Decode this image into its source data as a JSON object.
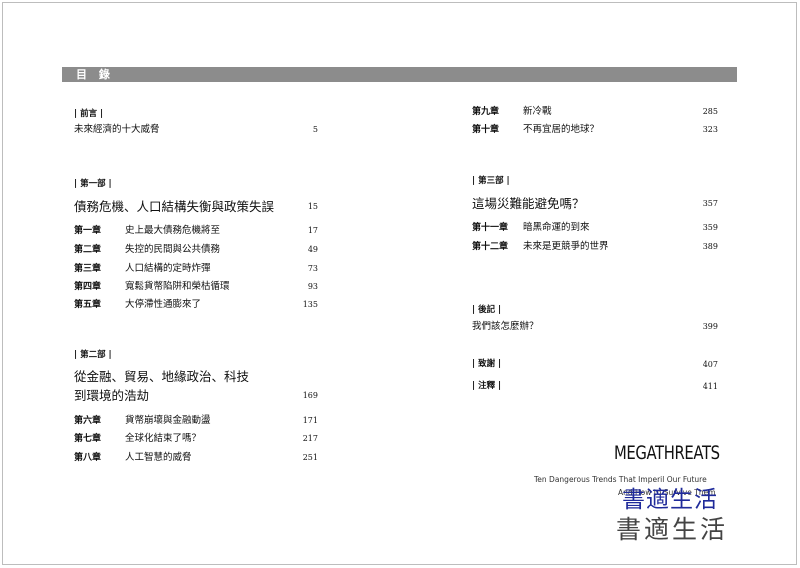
{
  "header": {
    "title": "目 錄"
  },
  "left": {
    "preface_tag": "| 前言 |",
    "preface": {
      "title": "未來經濟的十大威脅",
      "page": "5"
    },
    "part1": {
      "tag": "| 第一部 |",
      "title": "債務危機、人口結構失衡與政策失誤",
      "page": "15",
      "chapters": [
        {
          "num": "第一章",
          "title": "史上最大債務危機將至",
          "page": "17"
        },
        {
          "num": "第二章",
          "title": "失控的民間與公共債務",
          "page": "49"
        },
        {
          "num": "第三章",
          "title": "人口結構的定時炸彈",
          "page": "73"
        },
        {
          "num": "第四章",
          "title": "寬鬆貨幣陷阱和榮枯循環",
          "page": "93"
        },
        {
          "num": "第五章",
          "title": "大停滯性通膨來了",
          "page": "135"
        }
      ]
    },
    "part2": {
      "tag": "| 第二部 |",
      "title_line1": "從金融、貿易、地緣政治、科技",
      "title_line2": "到環境的浩劫",
      "page": "169",
      "chapters": [
        {
          "num": "第六章",
          "title": "貨幣崩壞與金融動盪",
          "page": "171"
        },
        {
          "num": "第七章",
          "title": "全球化結束了嗎？",
          "page": "217"
        },
        {
          "num": "第八章",
          "title": "人工智慧的威脅",
          "page": "251"
        }
      ]
    }
  },
  "right": {
    "chapters_top": [
      {
        "num": "第九章",
        "title": "新冷戰",
        "page": "285"
      },
      {
        "num": "第十章",
        "title": "不再宜居的地球？",
        "page": "323"
      }
    ],
    "part3": {
      "tag": "| 第三部 |",
      "title": "這場災難能避免嗎？",
      "page": "357",
      "chapters": [
        {
          "num": "第十一章",
          "title": "暗黑命運的到來",
          "page": "359"
        },
        {
          "num": "第十二章",
          "title": "未來是更競爭的世界",
          "page": "389"
        }
      ]
    },
    "afterword_tag": "| 後記 |",
    "afterword": {
      "title": "我們該怎麼辦？",
      "page": "399"
    },
    "thanks": {
      "tag": "| 致謝 |",
      "page": "407"
    },
    "notes": {
      "tag": "| 注釋 |",
      "page": "411"
    }
  },
  "logo": {
    "title": "MEGATHREATS",
    "subtitle_line1": "Ten Dangerous Trends That Imperil Our Future",
    "subtitle_line2": "And How to Survive Them",
    "watermark_blue": "書適生活",
    "watermark_gray": "書適生活"
  }
}
